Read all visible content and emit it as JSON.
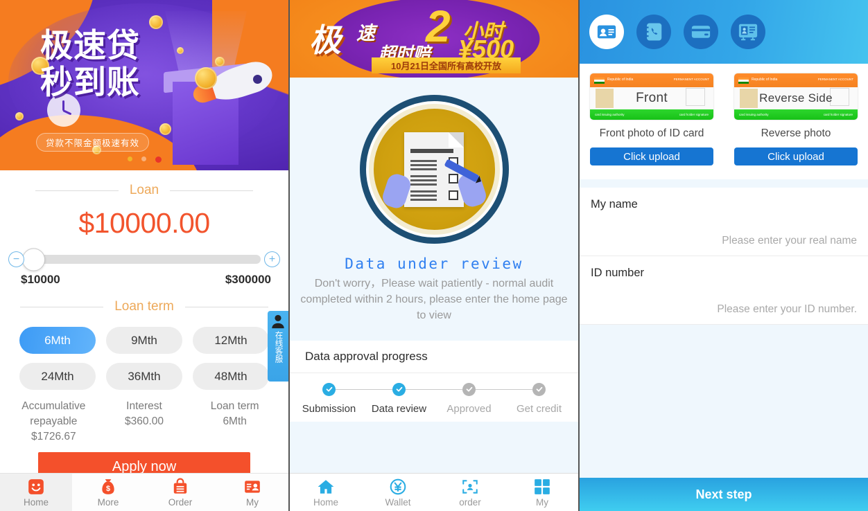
{
  "panel_loan": {
    "banner": {
      "title_line1": "极速贷",
      "title_line2": "秒到账",
      "subtitle": "贷款不限金额极速有效",
      "dots": [
        "",
        "",
        ""
      ]
    },
    "loan_section_label": "Loan",
    "amount": "$10000.00",
    "slider": {
      "minus_label": "−",
      "plus_label": "+",
      "min_label": "$10000",
      "max_label": "$300000"
    },
    "term_section_label": "Loan term",
    "terms": [
      {
        "label": "6Mth",
        "selected": true
      },
      {
        "label": "9Mth",
        "selected": false
      },
      {
        "label": "12Mth",
        "selected": false
      },
      {
        "label": "24Mth",
        "selected": false
      },
      {
        "label": "36Mth",
        "selected": false
      },
      {
        "label": "48Mth",
        "selected": false
      }
    ],
    "summary": [
      {
        "title": "Accumulative repayable",
        "value": "$1726.67"
      },
      {
        "title": "Interest",
        "value": "$360.00"
      },
      {
        "title": "Loan term",
        "value": "6Mth"
      }
    ],
    "apply_label": "Apply now",
    "customer_service": {
      "text": "在线客服"
    },
    "tabbar": [
      {
        "label": "Home",
        "icon": "smiley-face-icon",
        "active": true
      },
      {
        "label": "More",
        "icon": "money-bag-icon",
        "active": false
      },
      {
        "label": "Order",
        "icon": "shopping-bag-icon",
        "active": false
      },
      {
        "label": "My",
        "icon": "id-card-icon",
        "active": false
      }
    ],
    "accent_color": "#f4502b",
    "selected_term_color": "#3d9bf5"
  },
  "panel_review": {
    "promo": {
      "word1": "极",
      "word2": "速",
      "big_number": "2",
      "hours": "小时",
      "word3": "超时赔",
      "yen": "¥500",
      "ribbon": "10月21日全国所有高校开放"
    },
    "status_title": "Data under review",
    "status_desc": "Don't worry，Please wait patiently - normal audit completed within 2 hours, please enter the home page to view",
    "progress_title": "Data approval progress",
    "steps": [
      {
        "label": "Submission",
        "done": true
      },
      {
        "label": "Data review",
        "done": true
      },
      {
        "label": "Approved",
        "done": false
      },
      {
        "label": "Get credit",
        "done": false
      }
    ],
    "tabbar": [
      {
        "label": "Home",
        "icon": "house-icon",
        "active": true
      },
      {
        "label": "Wallet",
        "icon": "yen-circle-icon",
        "active": false
      },
      {
        "label": "order",
        "icon": "scan-person-icon",
        "active": false
      },
      {
        "label": "My",
        "icon": "grid-squares-icon",
        "active": false
      }
    ],
    "accent_color": "#2aade3",
    "status_color": "#2f7ff0"
  },
  "panel_verify": {
    "header_steps": [
      {
        "icon": "id-card-icon",
        "active": true
      },
      {
        "icon": "phone-contacts-icon",
        "active": false
      },
      {
        "icon": "bank-card-icon",
        "active": false
      },
      {
        "icon": "certificate-card-icon",
        "active": false
      }
    ],
    "uploads": [
      {
        "card_word": "Front",
        "card_country": "Republic of India",
        "card_top_right": "PERMANENT ACCOUNT",
        "card_bottom_left": "card issuing authority",
        "card_bottom_right": "card holder signature",
        "caption": "Front photo of ID card",
        "button": "Click upload"
      },
      {
        "card_word": "Reverse Side",
        "card_country": "Republic of India",
        "card_top_right": "PERMANENT ACCOUNT",
        "card_bottom_left": "card issuing authority",
        "card_bottom_right": "card holder signature",
        "caption": "Reverse photo",
        "button": "Click upload"
      }
    ],
    "fields": [
      {
        "label": "My name",
        "placeholder": "Please enter your real name",
        "value": ""
      },
      {
        "label": "ID number",
        "placeholder": "Please enter your ID number.",
        "value": ""
      }
    ],
    "next_label": "Next step",
    "accent_color": "#1675d2",
    "header_color": "#2a92e0"
  }
}
